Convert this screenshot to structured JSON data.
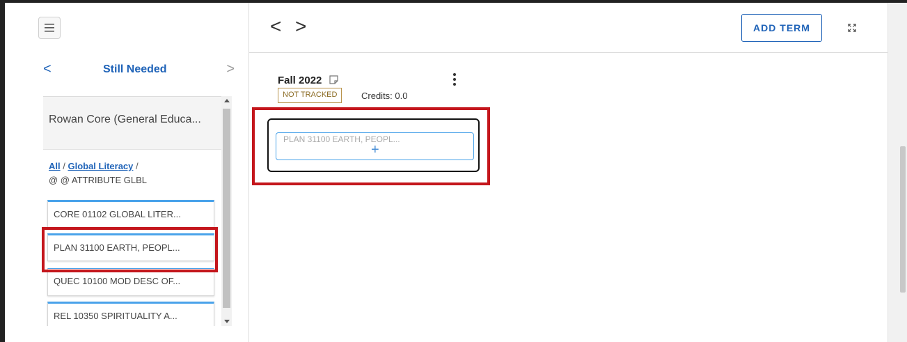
{
  "left_panel": {
    "nav_prev": "<",
    "nav_next": ">",
    "title": "Still Needed",
    "requirement_header": "Rowan Core (General Educa...",
    "breadcrumb": {
      "all": "All",
      "sep1": " / ",
      "global": "Global Literacy",
      "sep2": " /",
      "attribute": "@ @ ATTRIBUTE GLBL"
    },
    "courses": [
      "CORE 01102  GLOBAL LITER...",
      "PLAN 31100  EARTH, PEOPL...",
      "QUEC 10100  MOD DESC OF...",
      "REL 10350  SPIRITUALITY A..."
    ]
  },
  "top_bar": {
    "prev": "<",
    "next": ">",
    "add_term": "ADD TERM"
  },
  "term": {
    "name": "Fall 2022",
    "status": "NOT TRACKED",
    "credits": "Credits:  0.0",
    "drop_ghost": "PLAN  31100  EARTH, PEOPL...",
    "add_symbol": "+"
  },
  "colors": {
    "link_blue": "#1f63b8",
    "card_accent": "#4aa3ea",
    "highlight_red": "#c4161c",
    "badge_gold": "#b8924a"
  }
}
